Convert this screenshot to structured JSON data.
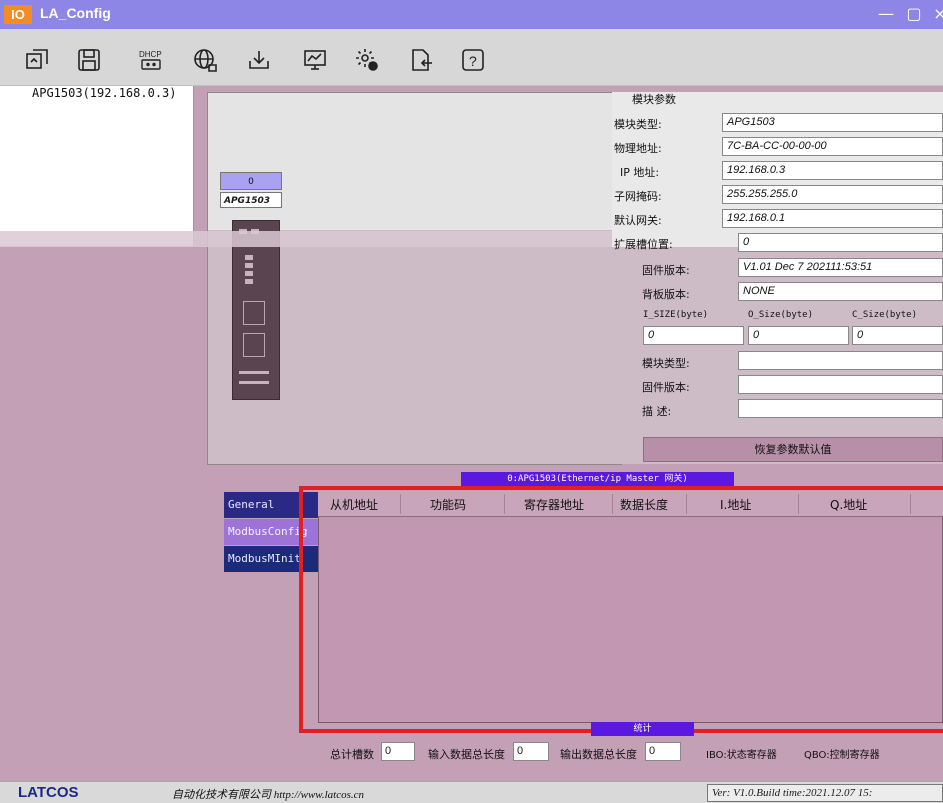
{
  "window": {
    "logo": "IO",
    "title": "LA_Config",
    "minimize_glyph": "—",
    "maximize_glyph": "▢",
    "close_glyph": "×"
  },
  "toolbar": {
    "items": [
      {
        "name": "scan-icon"
      },
      {
        "name": "save-icon"
      },
      {
        "name": "dhcp-icon",
        "label": "DHCP"
      },
      {
        "name": "network-icon"
      },
      {
        "name": "download-icon"
      },
      {
        "name": "monitor-icon"
      },
      {
        "name": "settings-icon"
      },
      {
        "name": "export-icon"
      },
      {
        "name": "help-icon",
        "label": "?"
      }
    ]
  },
  "tree": {
    "items": [
      {
        "label": "APG1503(192.168.0.3)"
      }
    ]
  },
  "device": {
    "slot_index": "0",
    "model": "APG1503"
  },
  "params": {
    "group_title": "模块参数",
    "rows": [
      {
        "label": "模块类型:",
        "value": "APG1503"
      },
      {
        "label": "物理地址:",
        "value": "7C-BA-CC-00-00-00"
      },
      {
        "label": "IP 地址:",
        "value": "192.168.0.3"
      },
      {
        "label": "子网掩码:",
        "value": "255.255.255.0"
      },
      {
        "label": "默认网关:",
        "value": "192.168.0.1"
      },
      {
        "label": "扩展槽位置:",
        "value": "0"
      },
      {
        "label": "固件版本:",
        "value": "V1.01 Dec 7 202111:53:51"
      },
      {
        "label": "背板版本:",
        "value": "NONE"
      }
    ],
    "size_headers": [
      "I_SIZE(byte)",
      "O_Size(byte)",
      "C_Size(byte)"
    ],
    "size_values": [
      "0",
      "0",
      "0"
    ],
    "sub_rows": [
      {
        "label": "模块类型:",
        "value": ""
      },
      {
        "label": "固件版本:",
        "value": ""
      },
      {
        "label": "描    述:",
        "value": ""
      }
    ],
    "restore_button": "恢复参数默认值"
  },
  "bottom": {
    "tab_label": "0:APG1503(Ethernet/ip Master 网关)",
    "side_buttons": [
      {
        "label": "General"
      },
      {
        "label": "ModbusConfig"
      },
      {
        "label": "ModbusMInit"
      }
    ],
    "table_headers": [
      "从机地址",
      "功能码",
      "寄存器地址",
      "数据长度",
      "I.地址",
      "Q.地址"
    ],
    "summary_bar": "统计",
    "footer": {
      "total_slots_label": "总计槽数",
      "total_slots_value": "0",
      "input_len_label": "输入数据总长度",
      "input_len_value": "0",
      "output_len_label": "输出数据总长度",
      "output_len_value": "0",
      "ibo_note": "IBO:状态寄存器",
      "qbo_note": "QBO:控制寄存器"
    }
  },
  "status": {
    "brand": "LATCOS",
    "company": "自动化技术有限公司 http://www.latcos.cn",
    "version": "Ver: V1.0.Build time:2021.12.07 15:"
  },
  "colors": {
    "titlebar": "#8d86e6",
    "background": "#c4a0b6",
    "accent_tab": "#5b18e0",
    "highlight_frame": "#e32021"
  }
}
